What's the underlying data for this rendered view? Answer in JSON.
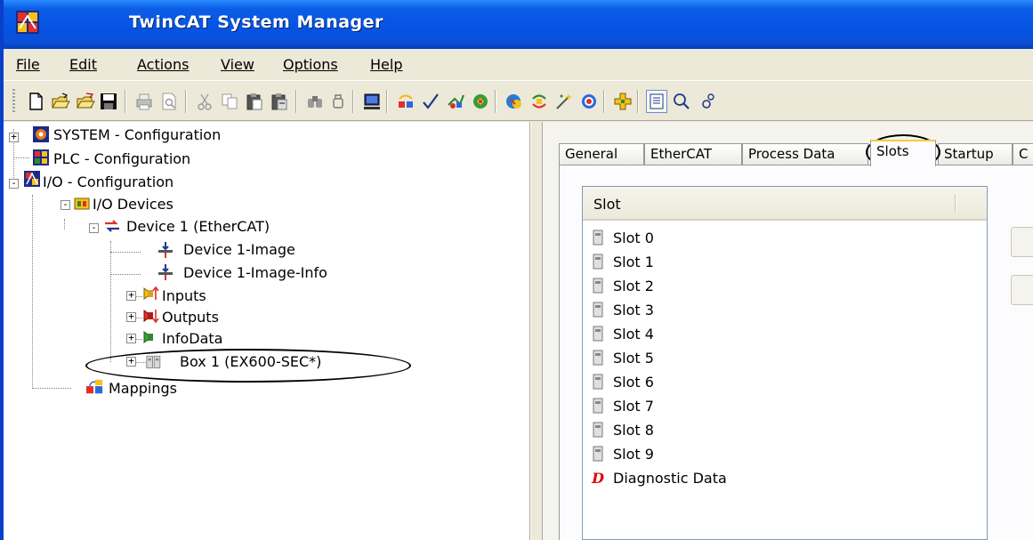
{
  "window": {
    "title": "TwinCAT System Manager",
    "titlebar_color": "#0554e3"
  },
  "menu": {
    "items": [
      {
        "label": "File",
        "underline": "F"
      },
      {
        "label": "Edit",
        "underline": "E"
      },
      {
        "label": "Actions",
        "underline": "A"
      },
      {
        "label": "View",
        "underline": "V"
      },
      {
        "label": "Options",
        "underline": "O"
      },
      {
        "label": "Help",
        "underline": "H"
      }
    ]
  },
  "toolbar": {
    "buttons": [
      "new-icon",
      "open-icon",
      "open-folder-icon",
      "save-icon",
      "print-icon",
      "print-preview-icon",
      "cut-icon",
      "copy-icon",
      "paste-icon",
      "paste-special-icon",
      "find-icon",
      "find-next-icon",
      "target-system-icon",
      "generate-mappings-icon",
      "check-configuration-icon",
      "activate-configuration-icon",
      "set-run-mode-icon",
      "scan-devices-icon",
      "reload-devices-icon",
      "wizard-icon",
      "free-run-icon",
      "add-item-icon",
      "show-online-icon",
      "zoom-icon",
      "more-icon"
    ]
  },
  "tree": {
    "nodes": [
      {
        "label": "SYSTEM - Configuration",
        "icon": "system-config-icon",
        "toggle": "+"
      },
      {
        "label": "PLC - Configuration",
        "icon": "plc-config-icon",
        "toggle": ""
      },
      {
        "label": "I/O - Configuration",
        "icon": "io-config-icon",
        "toggle": "-"
      },
      {
        "label": "I/O Devices",
        "icon": "io-devices-icon",
        "toggle": "-"
      },
      {
        "label": "Device 1 (EtherCAT)",
        "icon": "ethercat-device-icon",
        "toggle": "-"
      },
      {
        "label": "Device 1-Image",
        "icon": "device-image-icon",
        "toggle": ""
      },
      {
        "label": "Device 1-Image-Info",
        "icon": "device-image-info-icon",
        "toggle": ""
      },
      {
        "label": "Inputs",
        "icon": "inputs-icon",
        "toggle": "+"
      },
      {
        "label": "Outputs",
        "icon": "outputs-icon",
        "toggle": "+"
      },
      {
        "label": "InfoData",
        "icon": "infodata-icon",
        "toggle": "+"
      },
      {
        "label": "Box 1 (EX600-SEC*)",
        "icon": "box-module-icon",
        "toggle": "+"
      },
      {
        "label": "Mappings",
        "icon": "mappings-icon",
        "toggle": ""
      }
    ]
  },
  "tabs": {
    "items": [
      "General",
      "EtherCAT",
      "Process Data",
      "Slots",
      "Startup",
      "C"
    ],
    "active": "Slots"
  },
  "slot_list": {
    "header": "Slot",
    "rows": [
      "Slot 0",
      "Slot 1",
      "Slot 2",
      "Slot 3",
      "Slot 4",
      "Slot 5",
      "Slot 6",
      "Slot 7",
      "Slot 8",
      "Slot 9",
      "Diagnostic Data"
    ],
    "diagnostic_glyph": "D",
    "diagnostic_color": "#e00000"
  }
}
